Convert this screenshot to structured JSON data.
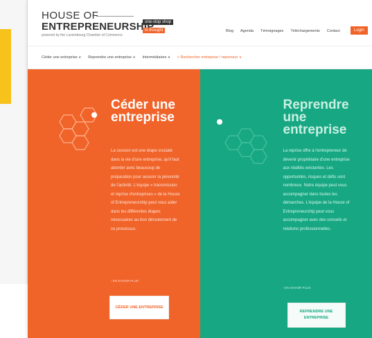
{
  "header": {
    "logo_top": "HOUSE OF",
    "logo_main": "ENTREPRENEURSHIP",
    "logo_sub": "powered by the Luxembourg Chamber of Commerce",
    "tag_one": "one-stop shop",
    "tag_two": "in thought",
    "nav_items": [
      "Blog",
      "Agenda",
      "Témoignages",
      "Téléchargements",
      "Contact"
    ],
    "login_label": "Login"
  },
  "main_nav": {
    "items": [
      "Céder une entreprise ∨",
      "Reprendre une entreprise ∨",
      "Intermédiaires ∨"
    ],
    "search_label": "Rechercher entreprise / repreneur ∨"
  },
  "hero": {
    "left": {
      "title": "Céder une entreprise",
      "body": "La cession est une étape cruciale dans la vie d'une entreprise, qu'il faut aborder avec beaucoup de préparation pour assurer la pérennité de l'activité. L'équipe « transmission et reprise d'entreprises » de la House of Entrepreneurship peut vous aider dans les différentes étapes nécessaires au bon déroulement de ce processus.",
      "small_link": "› EN SAVOIR PLUS",
      "cta_label": "CÉDER UNE ENTREPRISE"
    },
    "right": {
      "title": "Reprendre une entreprise",
      "body": "La reprise offre à l'entrepreneur de devenir propriétaire d'une entreprise aux réalités existantes. Les opportunités, risques et défis sont nombreux. Notre équipe peut vous accompagner dans toutes les démarches. L'équipe de la House of Entrepreneurship peut vous accompagner avec des conseils et relations professionnelles.",
      "small_link": "› EN SAVOIR PLUS",
      "cta_label": "REPRENDRE UNE ENTREPRISE"
    }
  },
  "colors": {
    "accent_orange": "#f0642a",
    "accent_green": "#17a883",
    "left_strip_yellow": "#f7c21a"
  },
  "icons": {
    "left_art": "hexagon-network-icon",
    "right_art": "hexagon-network-icon"
  }
}
